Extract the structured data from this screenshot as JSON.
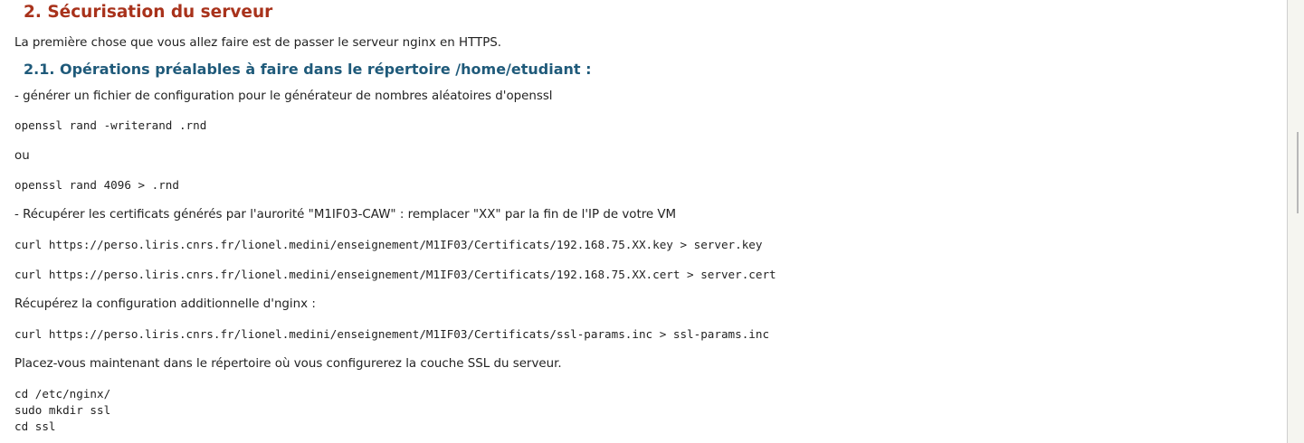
{
  "section": {
    "title": "2. Sécurisation du serveur",
    "intro": "La première chose que vous allez faire est de passer le serveur nginx en HTTPS."
  },
  "subsection": {
    "title": "2.1. Opérations préalables à faire dans le répertoire /home/etudiant :"
  },
  "blocks": {
    "gen_text": "- générer un fichier de configuration pour le générateur de nombres aléatoires d'openssl",
    "cmd_writerand": "openssl rand -writerand .rnd",
    "ou_text": "ou",
    "cmd_rand4096": "openssl rand 4096 > .rnd",
    "cert_text": "- Récupérer les certificats générés par l'aurorité \"M1IF03-CAW\" : remplacer \"XX\" par la fin de l'IP de votre VM",
    "cmd_curl_key": "curl https://perso.liris.cnrs.fr/lionel.medini/enseignement/M1IF03/Certificats/192.168.75.XX.key > server.key",
    "cmd_curl_cert": "curl https://perso.liris.cnrs.fr/lionel.medini/enseignement/M1IF03/Certificats/192.168.75.XX.cert > server.cert",
    "conf_text": "Récupérez la configuration additionnelle d'nginx :",
    "cmd_curl_ssl": "curl https://perso.liris.cnrs.fr/lionel.medini/enseignement/M1IF03/Certificats/ssl-params.inc > ssl-params.inc",
    "place_text": "Placez-vous maintenant dans le répertoire où vous configurerez la couche SSL du serveur.",
    "cmd_cd_nginx": "cd /etc/nginx/",
    "cmd_mkdir": "sudo mkdir ssl",
    "cmd_cd_ssl": "cd ssl"
  },
  "colors": {
    "section_title": "#a8321b",
    "subsection_title": "#1f5a7a",
    "text": "#222222",
    "background": "#ffffff"
  }
}
